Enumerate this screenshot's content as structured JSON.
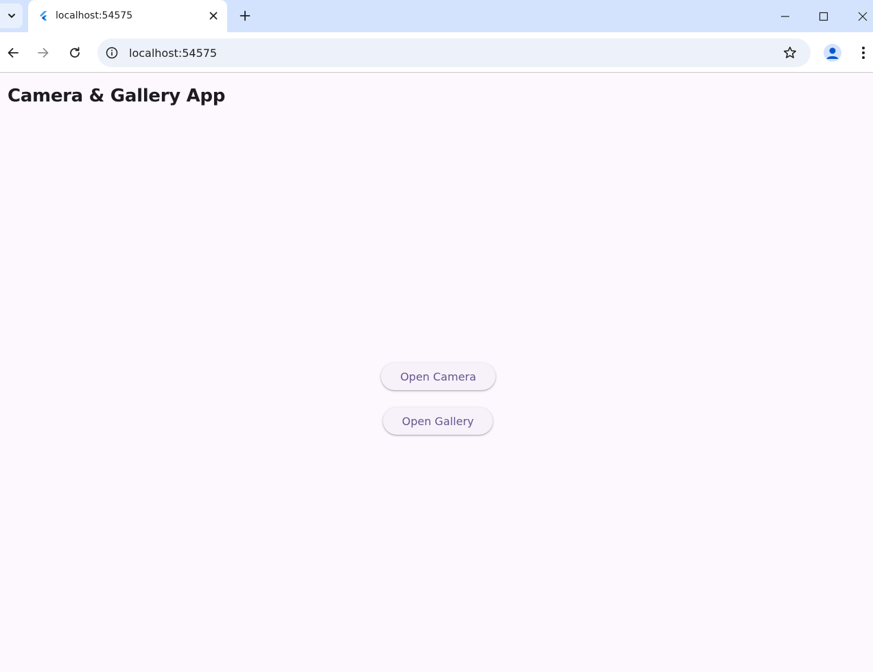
{
  "browser": {
    "tab": {
      "title": "localhost:54575",
      "favicon": "flutter-icon"
    },
    "address_bar": {
      "url": "localhost:54575"
    },
    "icons": {
      "tab_search": "chevron-down-icon",
      "tab_close": "close-icon",
      "new_tab": "plus-icon",
      "minimize": "minimize-icon",
      "maximize": "maximize-icon",
      "close_window": "close-window-icon",
      "back": "back-arrow-icon",
      "forward": "forward-arrow-icon",
      "reload": "reload-icon",
      "site_info": "info-icon",
      "bookmark": "star-icon",
      "profile": "profile-icon",
      "menu": "more-vert-icon"
    }
  },
  "app": {
    "title": "Camera & Gallery App",
    "buttons": {
      "camera_label": "Open Camera",
      "gallery_label": "Open Gallery"
    }
  },
  "colors": {
    "page_background": "#fdf7fe",
    "button_text": "#65558f",
    "button_background": "#f7f2fa",
    "tabstrip": "#d3e3fd"
  }
}
